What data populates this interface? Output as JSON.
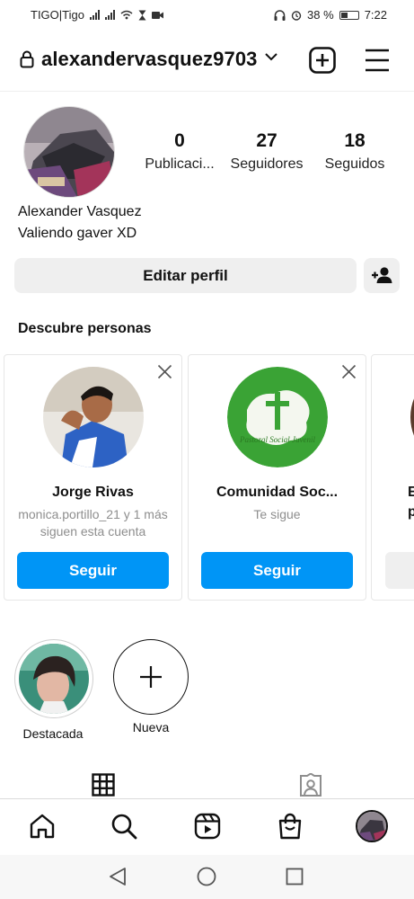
{
  "status_bar": {
    "carrier": "TIGO|Tigo",
    "battery": "38 %",
    "time": "7:22"
  },
  "header": {
    "username": "alexandervasquez9703",
    "icons": [
      "lock-icon",
      "chevron-down-icon",
      "new-post-icon",
      "menu-icon"
    ]
  },
  "profile": {
    "stats": [
      {
        "value": "0",
        "label": "Publicaci..."
      },
      {
        "value": "27",
        "label": "Seguidores"
      },
      {
        "value": "18",
        "label": "Seguidos"
      }
    ],
    "name": "Alexander Vasquez",
    "bio": "Valiendo gaver XD",
    "edit_button": "Editar perfil"
  },
  "discover": {
    "title": "Descubre personas",
    "cards": [
      {
        "name": "Jorge Rivas",
        "subtitle": "monica.portillo_21 y 1 más siguen esta cuenta",
        "button": "Seguir"
      },
      {
        "name": "Comunidad Soc...",
        "subtitle": "Te sigue",
        "button": "Seguir",
        "logo_text": "Pastoral Social Juvenil"
      },
      {
        "name": "E",
        "subtitle": "p",
        "button": ""
      }
    ]
  },
  "highlights": [
    {
      "label": "Destacada"
    },
    {
      "label": "Nueva"
    }
  ],
  "colors": {
    "follow_blue": "#0095f6",
    "button_gray": "#efefef",
    "green_logo": "#3aa335"
  }
}
